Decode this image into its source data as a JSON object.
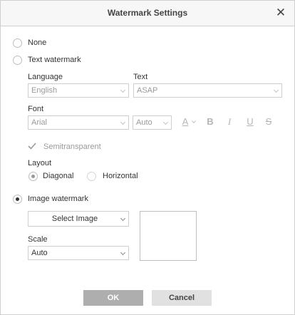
{
  "dialog": {
    "title": "Watermark Settings",
    "close_glyph": "✕"
  },
  "options": {
    "none_label": "None",
    "text_label": "Text watermark",
    "image_label": "Image watermark",
    "selected": "image"
  },
  "text_wm": {
    "language_label": "Language",
    "language_value": "English",
    "text_label": "Text",
    "text_value": "ASAP",
    "font_label": "Font",
    "font_value": "Arial",
    "size_value": "Auto",
    "format_glyphs": {
      "color": "A",
      "bold": "B",
      "italic": "I",
      "underline": "U",
      "strike": "S"
    },
    "semitransparent_label": "Semitransparent",
    "semitransparent_checked": true,
    "layout_label": "Layout",
    "diagonal_label": "Diagonal",
    "horizontal_label": "Horizontal",
    "layout_selected": "diagonal"
  },
  "image_wm": {
    "select_image_label": "Select Image",
    "scale_label": "Scale",
    "scale_value": "Auto"
  },
  "footer": {
    "ok_label": "OK",
    "cancel_label": "Cancel"
  },
  "icons": [
    "close-icon",
    "chevron-down-icon",
    "font-color-icon",
    "bold-icon",
    "italic-icon",
    "underline-icon",
    "strikethrough-icon",
    "checkmark-icon"
  ]
}
